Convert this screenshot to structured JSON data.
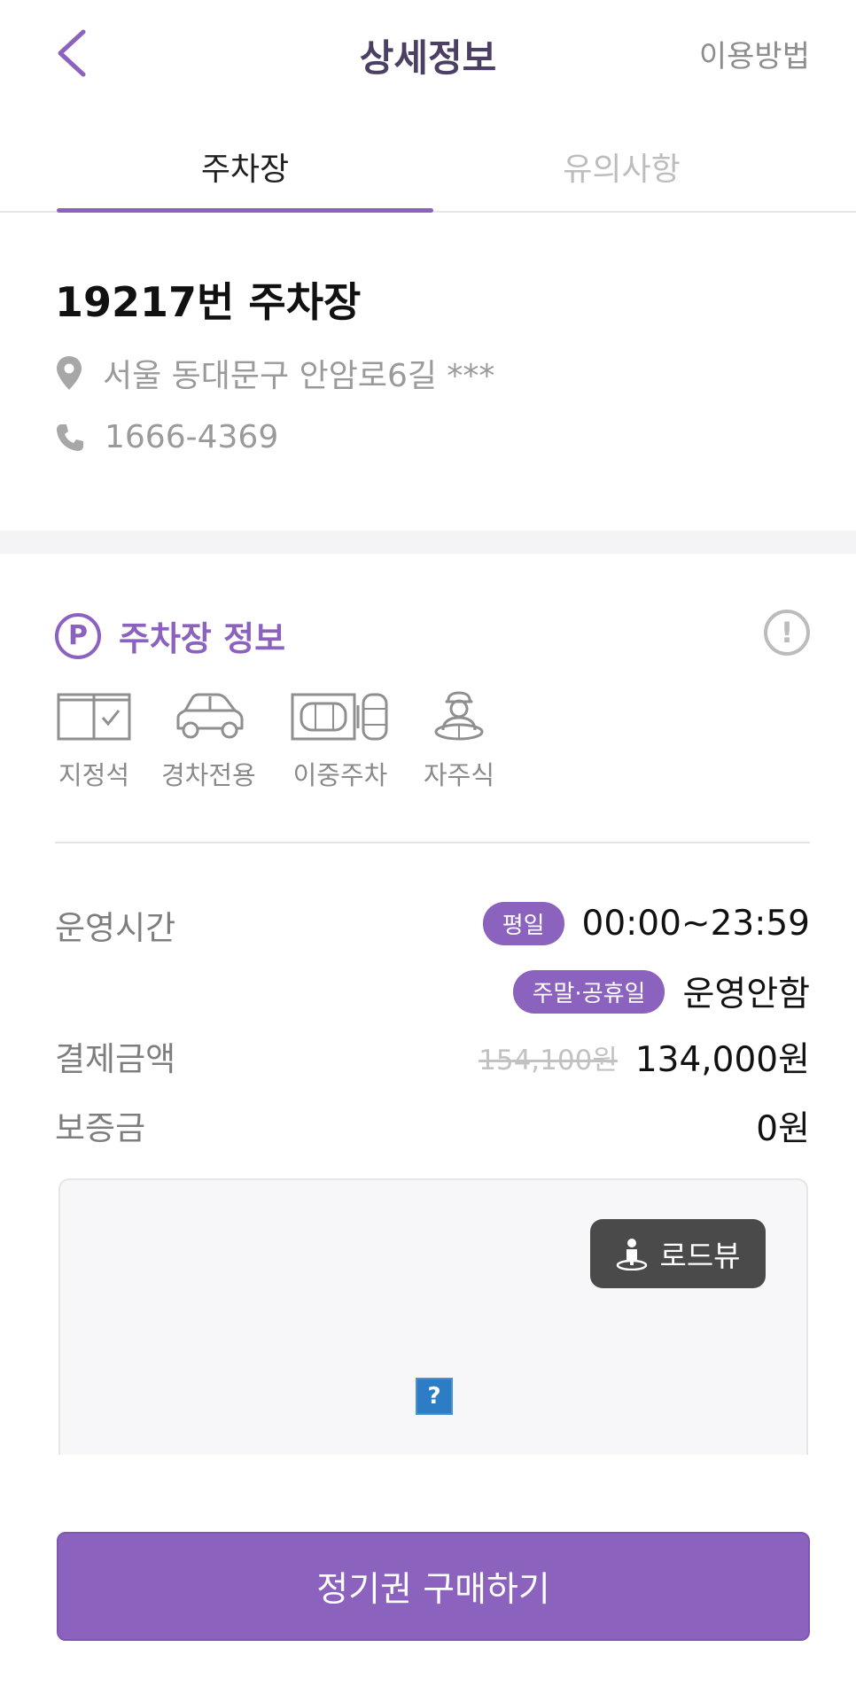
{
  "header": {
    "title": "상세정보",
    "help_link": "이용방법"
  },
  "tabs": [
    {
      "label": "주차장",
      "active": true
    },
    {
      "label": "유의사항",
      "active": false
    }
  ],
  "lot": {
    "name": "19217번 주차장",
    "address": "서울 동대문구 안암로6길 ***",
    "phone": "1666-4369"
  },
  "section": {
    "title": "주차장 정보",
    "badge_glyph": "P",
    "alert_glyph": "!"
  },
  "features": [
    {
      "label": "지정석",
      "icon": "reserved-spot-icon"
    },
    {
      "label": "경차전용",
      "icon": "compact-car-icon"
    },
    {
      "label": "이중주차",
      "icon": "double-parking-icon"
    },
    {
      "label": "자주식",
      "icon": "self-parking-driver-icon"
    }
  ],
  "details": {
    "hours_label": "운영시간",
    "weekday_tag": "평일",
    "weekday_hours": "00:00~23:59",
    "weekend_tag": "주말·공휴일",
    "weekend_hours": "운영안함",
    "price_label": "결제금액",
    "original_price": "154,100원",
    "price": "134,000원",
    "deposit_label": "보증금",
    "deposit": "0원"
  },
  "map": {
    "roadview_label": "로드뷰",
    "placeholder_glyph": "?"
  },
  "purchase": {
    "label": "정기권 구매하기"
  },
  "colors": {
    "accent": "#8b63bf",
    "title": "#4b3f63",
    "muted": "#9a9a9a"
  }
}
